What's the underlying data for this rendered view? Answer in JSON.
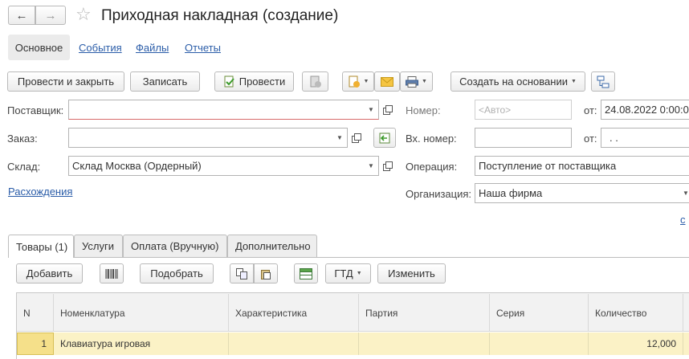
{
  "title": "Приходная накладная (создание)",
  "nav_tabs": [
    "Основное",
    "События",
    "Файлы",
    "Отчеты"
  ],
  "toolbar": {
    "post_close": "Провести и закрыть",
    "save": "Записать",
    "post": "Провести",
    "create_based": "Создать на основании"
  },
  "form": {
    "supplier_label": "Поставщик:",
    "supplier_value": "",
    "order_label": "Заказ:",
    "order_value": "",
    "warehouse_label": "Склад:",
    "warehouse_value": "Склад Москва (Ордерный)",
    "discrepancies_link": "Расхождения",
    "number_label": "Номер:",
    "number_placeholder": "<Авто>",
    "from_label": "от:",
    "date_value": "24.08.2022  0:00:0",
    "in_number_label": "Вх. номер:",
    "in_number_value": "",
    "from_label2": "от:",
    "in_date_value": " .  .",
    "operation_label": "Операция:",
    "operation_value": "Поступление от поставщика",
    "organization_label": "Организация:",
    "organization_value": "Наша фирма",
    "right_link": "с"
  },
  "tabs": [
    "Товары (1)",
    "Услуги",
    "Оплата (Вручную)",
    "Дополнительно"
  ],
  "table_toolbar": {
    "add": "Добавить",
    "select": "Подобрать",
    "gtd": "ГТД",
    "change": "Изменить"
  },
  "table": {
    "columns": [
      "N",
      "Номенклатура",
      "Характеристика",
      "Партия",
      "Серия",
      "Количество"
    ],
    "rows": [
      [
        "1",
        "Клавиатура игровая",
        "",
        "",
        "",
        "12,000"
      ]
    ]
  },
  "colors": {
    "accent_link": "#2a5ca8",
    "row_highlight": "#fbf2c6",
    "row_highlight_strong": "#f5e08a"
  }
}
